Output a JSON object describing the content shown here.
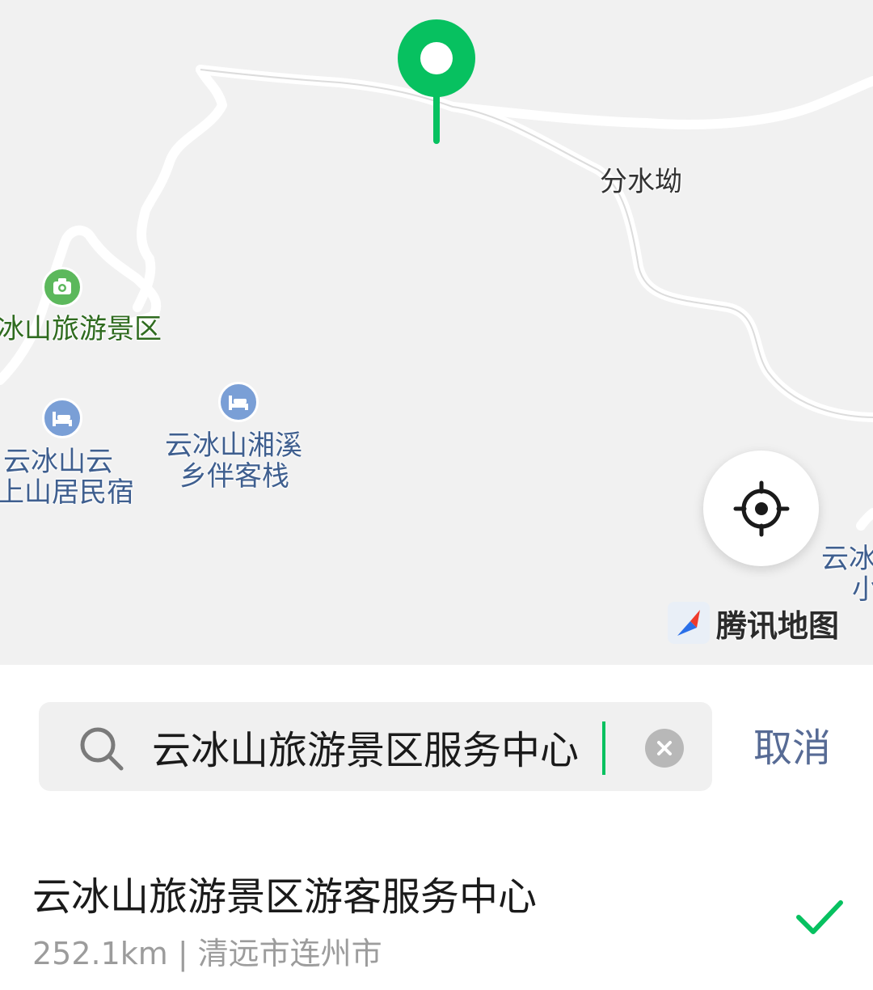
{
  "map": {
    "pois": [
      {
        "name": "分水坳",
        "kind": "place"
      },
      {
        "name": "冰山旅游景区",
        "kind": "scenic"
      },
      {
        "name_line1": "云冰山云",
        "name_line2": "上山居民宿",
        "kind": "hotel"
      },
      {
        "name_line1": "云冰山湘溪",
        "name_line2": "乡伴客栈",
        "kind": "hotel"
      },
      {
        "name_line1": "云冰",
        "name_line2": "小",
        "kind": "partial"
      }
    ],
    "brand": "腾讯地图",
    "colors": {
      "background": "#f1f1f1",
      "road": "#ffffff",
      "pin": "#07c160",
      "poi_blue": "#7a9fd6",
      "poi_green": "#5cb85c"
    }
  },
  "search": {
    "value": "云冰山旅游景区服务中心",
    "cancel_label": "取消"
  },
  "results": [
    {
      "title": "云冰山旅游景区游客服务中心",
      "distance": "252.1km",
      "region": "清远市连州市",
      "selected": true
    }
  ],
  "accent": "#07c160",
  "icons": [
    "map-pin-icon",
    "camera-icon",
    "bed-icon",
    "locate-icon",
    "tencent-map-logo-icon",
    "search-icon",
    "clear-icon",
    "check-icon"
  ]
}
